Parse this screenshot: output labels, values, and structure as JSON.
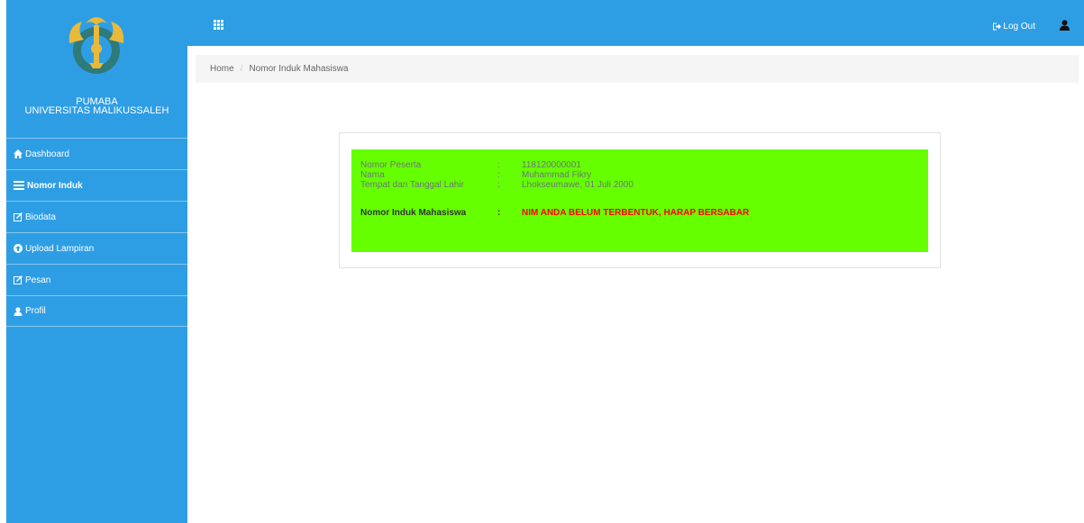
{
  "brand": {
    "line1": "PUMABA",
    "line2": "UNIVERSITAS MALIKUSSALEH"
  },
  "colors": {
    "primary": "#2e9ee4",
    "info_bg": "#66ff00",
    "alert": "#ff0000"
  },
  "sidebar": {
    "items": [
      {
        "label": "Dashboard",
        "icon": "home-icon"
      },
      {
        "label": "Nomor Induk",
        "icon": "list-icon",
        "active": true
      },
      {
        "label": "Biodata",
        "icon": "edit-icon"
      },
      {
        "label": "Upload Lampiran",
        "icon": "upload-icon"
      },
      {
        "label": "Pesan",
        "icon": "edit-icon"
      },
      {
        "label": "Profil",
        "icon": "user-icon"
      }
    ]
  },
  "topbar": {
    "menu_icon": "grid-icon",
    "logout_label": "Log Out",
    "logout_icon": "logout-icon",
    "user_icon": "user-icon"
  },
  "breadcrumb": {
    "home": "Home",
    "separator": "/",
    "current": "Nomor Induk Mahasiswa"
  },
  "student": {
    "colon": ":",
    "rows": [
      {
        "label": "Nomor Peserta",
        "value": "118120000001"
      },
      {
        "label": "Nama",
        "value": "Muhammad Fikry"
      },
      {
        "label": "Tempat dan Tanggal Lahir",
        "value": "Lhokseumawe, 01 Juli 2000"
      }
    ],
    "nim_label": "Nomor Induk Mahasiswa",
    "nim_value": "NIM ANDA BELUM TERBENTUK, HARAP BERSABAR"
  }
}
